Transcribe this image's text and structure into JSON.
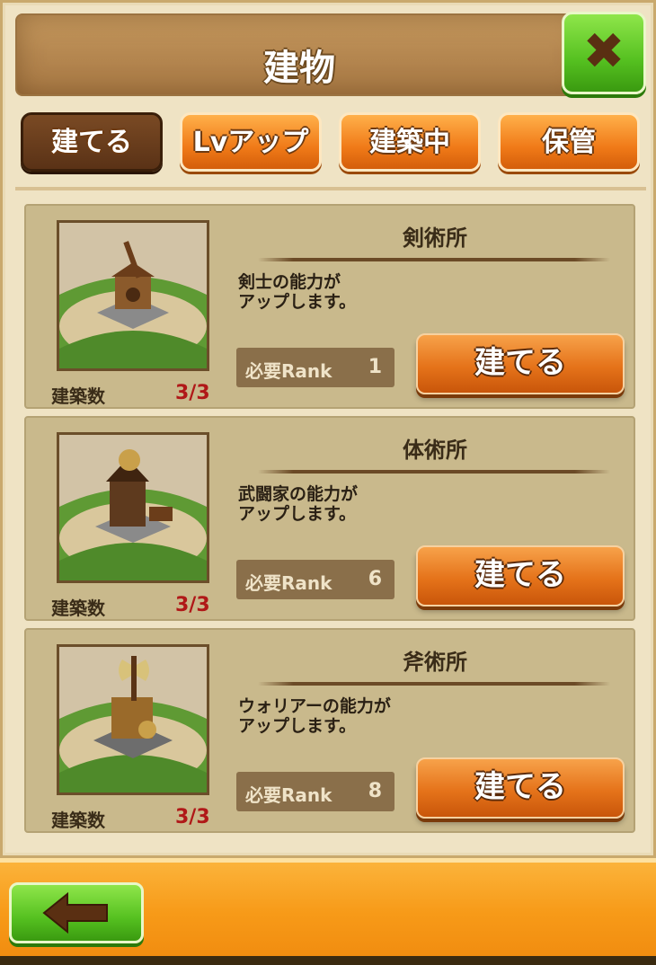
{
  "header": {
    "title": "建物",
    "close_icon": "✖"
  },
  "tabs": [
    {
      "label": "建てる",
      "active": true
    },
    {
      "label": "Lvアップ",
      "active": false
    },
    {
      "label": "建築中",
      "active": false
    },
    {
      "label": "保管",
      "active": false
    }
  ],
  "buildings": [
    {
      "name": "剣術所",
      "description": "剣士の能力が\nアップします。",
      "rank_label": "必要Rank",
      "rank_value": "1",
      "count_label": "建築数",
      "count_value": "3/3",
      "button_label": "建てる",
      "icon": "sword-training-building-icon"
    },
    {
      "name": "体術所",
      "description": "武闘家の能力が\nアップします。",
      "rank_label": "必要Rank",
      "rank_value": "6",
      "count_label": "建築数",
      "count_value": "3/3",
      "button_label": "建てる",
      "icon": "martial-arts-building-icon"
    },
    {
      "name": "斧術所",
      "description": "ウォリアーの能力が\nアップします。",
      "rank_label": "必要Rank",
      "rank_value": "8",
      "count_label": "建築数",
      "count_value": "3/3",
      "button_label": "建てる",
      "icon": "axe-training-building-icon"
    }
  ],
  "footer": {
    "back_icon": "arrow-left-icon"
  },
  "colors": {
    "accent": "#f07a18",
    "close_button": "#55c020",
    "count_value": "#b01818",
    "panel": "#c9b98c"
  }
}
